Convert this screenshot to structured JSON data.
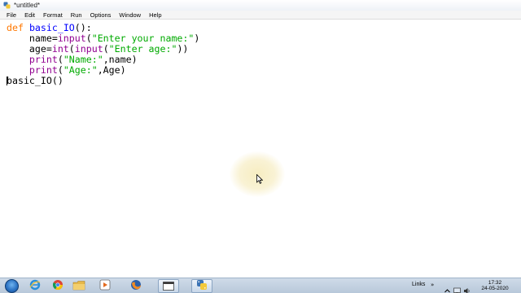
{
  "window": {
    "title": "*untitled*"
  },
  "menu": {
    "items": [
      "File",
      "Edit",
      "Format",
      "Run",
      "Options",
      "Window",
      "Help"
    ]
  },
  "editor": {
    "lines": [
      [
        {
          "t": "def",
          "c": "kw"
        },
        {
          "t": " "
        },
        {
          "t": "basic_IO",
          "c": "fn"
        },
        {
          "t": "():"
        }
      ],
      [
        {
          "t": "    name="
        },
        {
          "t": "input",
          "c": "bi"
        },
        {
          "t": "("
        },
        {
          "t": "\"Enter your name:\"",
          "c": "str"
        },
        {
          "t": ")"
        }
      ],
      [
        {
          "t": "    age="
        },
        {
          "t": "int",
          "c": "bi"
        },
        {
          "t": "("
        },
        {
          "t": "input",
          "c": "bi"
        },
        {
          "t": "("
        },
        {
          "t": "\"Enter age:\"",
          "c": "str"
        },
        {
          "t": "))"
        }
      ],
      [
        {
          "t": "    "
        },
        {
          "t": "print",
          "c": "bi"
        },
        {
          "t": "("
        },
        {
          "t": "\"Name:\"",
          "c": "str"
        },
        {
          "t": ",name)"
        }
      ],
      [
        {
          "t": "    "
        },
        {
          "t": "print",
          "c": "bi"
        },
        {
          "t": "("
        },
        {
          "t": "\"Age:\"",
          "c": "str"
        },
        {
          "t": ",Age)"
        }
      ],
      [
        {
          "t": "basic_IO()",
          "caret": true
        }
      ]
    ]
  },
  "colors": {
    "keyword": "#ff7700",
    "function_name": "#0000ff",
    "builtin": "#900090",
    "string": "#00aa00"
  },
  "taskbar": {
    "apps": [
      {
        "icon": "internet-explorer-icon",
        "active": false
      },
      {
        "icon": "chrome-icon",
        "active": false
      },
      {
        "icon": "file-explorer-icon",
        "active": false
      },
      {
        "icon": "media-player-icon",
        "active": false
      },
      {
        "icon": "firefox-icon",
        "active": false
      },
      {
        "icon": "window-icon",
        "active": true
      },
      {
        "icon": "python-idle-icon",
        "active": true
      }
    ],
    "links_label": "Links",
    "time": "17:32",
    "date": "24-05-2020"
  }
}
